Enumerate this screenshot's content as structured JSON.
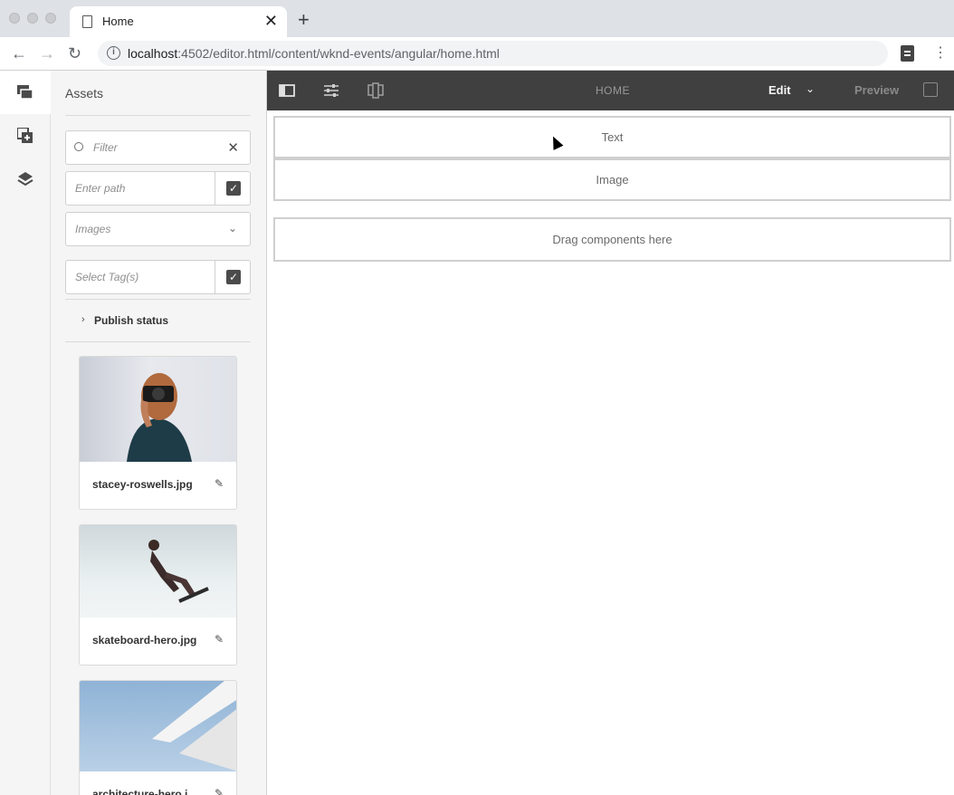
{
  "browser": {
    "tab_title": "Home",
    "tab_close": "✕",
    "new_tab": "+",
    "url_host": "localhost",
    "url_rest": ":4502/editor.html/content/wknd-events/angular/home.html"
  },
  "sidebar": {
    "title": "Assets",
    "filter_placeholder": "Filter",
    "path_placeholder": "Enter path",
    "type_select": "Images",
    "tags_placeholder": "Select Tag(s)",
    "publish_status": "Publish status"
  },
  "assets": [
    {
      "name": "stacey-roswells.jpg"
    },
    {
      "name": "skateboard-hero.jpg"
    },
    {
      "name": "architecture-hero.j"
    }
  ],
  "toolbar": {
    "page_name": "HOME",
    "mode": "Edit",
    "preview": "Preview"
  },
  "canvas": {
    "components": [
      "Text",
      "Image"
    ],
    "drop_zone": "Drag components here"
  }
}
